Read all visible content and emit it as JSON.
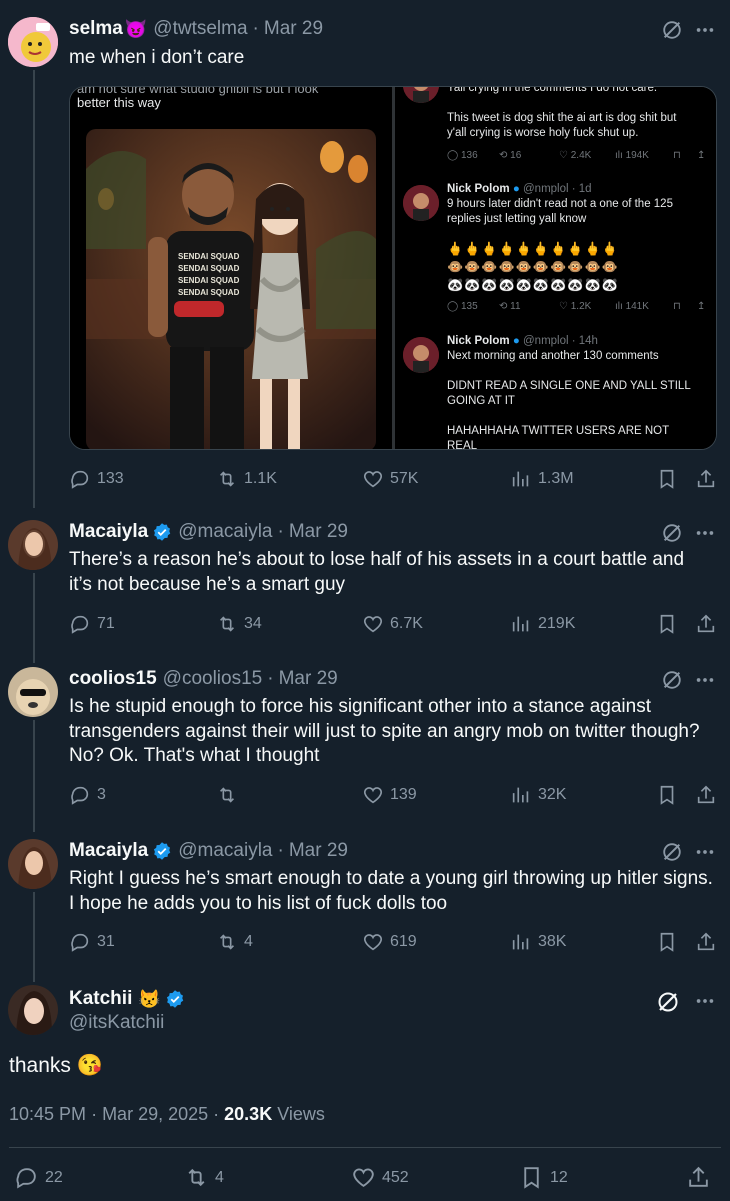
{
  "colors": {
    "bg": "#15202b",
    "text": "#f7f9f9",
    "muted": "#8b98a5",
    "verified": "#1d9bf0",
    "divider": "#38444d"
  },
  "tweets": [
    {
      "name": "selma",
      "name_emoji": "😈",
      "handle": "@twtselma",
      "date": "Mar 29",
      "text": [
        "me when i don’t care"
      ],
      "verified": false,
      "stats": {
        "replies": "133",
        "reposts": "1.1K",
        "likes": "57K",
        "views": "1.3M"
      },
      "media": {
        "left_caption_top": "am not sure what studio ghibli is but I look",
        "left_caption": "better this way",
        "shirt_lines": [
          "SENDAI SQUAD",
          "SENDAI SQUAD",
          "SENDAI SQUAD",
          "SENDAI SQUAD"
        ],
        "right": {
          "top_cut": "Yall crying in the comments I do not care.",
          "top_text": [
            "This tweet is dog shit the ai art is dog shit but",
            "y'all crying is worse holy fuck shut up."
          ],
          "top_stats": [
            "136",
            "16",
            "2.4K",
            "194K"
          ],
          "post1": {
            "name": "Nick Polom",
            "handle": "@nmplol · 1d",
            "text": [
              "9 hours later didn't read not a one of the 125",
              "replies just letting yall know"
            ],
            "emoji_rows": [
              "🖕🖕🖕🖕🖕🖕🖕🖕🖕🖕",
              "🐵🐵🐵🐵🐵🐵🐵🐵🐵🐵",
              "🐼🐼🐼🐼🐼🐼🐼🐼🐼🐼"
            ],
            "stats": [
              "135",
              "11",
              "1.2K",
              "141K"
            ]
          },
          "post2": {
            "name": "Nick Polom",
            "handle": "@nmplol · 14h",
            "text": [
              "Next morning and another 130 comments",
              "",
              "DIDNT READ A SINGLE ONE AND YALL STILL",
              "GOING AT IT",
              "",
              "HAHAHHAHA TWITTER USERS ARE NOT",
              "REAL"
            ]
          }
        }
      }
    },
    {
      "name": "Macaiyla",
      "handle": "@macaiyla",
      "date": "Mar 29",
      "verified": true,
      "text": [
        "There’s a reason he’s about to lose half of his assets in a court battle and",
        "it’s not because he’s a smart guy"
      ],
      "stats": {
        "replies": "71",
        "reposts": "34",
        "likes": "6.7K",
        "views": "219K"
      }
    },
    {
      "name": "coolios15",
      "handle": "@coolios15",
      "date": "Mar 29",
      "verified": false,
      "text": [
        "Is he stupid enough to force his significant other into a stance against",
        "transgenders against their will just to spite an angry mob on twitter though?",
        "No? Ok. That's what I thought"
      ],
      "stats": {
        "replies": "3",
        "reposts": "",
        "likes": "139",
        "views": "32K"
      }
    },
    {
      "name": "Macaiyla",
      "handle": "@macaiyla",
      "date": "Mar 29",
      "verified": true,
      "text": [
        "Right I guess he’s smart enough to date a young girl throwing up hitler signs.",
        "I hope he adds you to his list of fuck dolls too"
      ],
      "stats": {
        "replies": "31",
        "reposts": "4",
        "likes": "619",
        "views": "38K"
      }
    }
  ],
  "main": {
    "name": "Katchii",
    "name_emoji": "😾",
    "handle": "@itsKatchii",
    "text": "thanks",
    "text_emoji": "😘",
    "time": "10:45 PM",
    "date": "Mar 29, 2025",
    "views_count": "20.3K",
    "views_label": "Views",
    "stats": {
      "replies": "22",
      "reposts": "4",
      "likes": "452",
      "bookmarks": "12"
    }
  }
}
